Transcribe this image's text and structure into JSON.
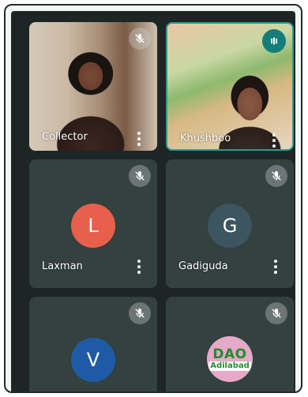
{
  "participants": [
    {
      "name": "Collector",
      "type": "video",
      "muted": true
    },
    {
      "name": "Khushboo",
      "type": "video",
      "speaking": true
    },
    {
      "name": "Laxman",
      "type": "avatar",
      "initial": "L",
      "avatar_color": "#e8604c",
      "muted": true
    },
    {
      "name": "Gadiguda",
      "type": "avatar",
      "initial": "G",
      "avatar_color": "#3c5560",
      "muted": true
    },
    {
      "name": "",
      "type": "avatar",
      "initial": "V",
      "avatar_color": "#1f5aa6",
      "muted": true
    },
    {
      "name": "",
      "type": "logo",
      "logo_text": "DAO",
      "logo_subtext": "Adilabad",
      "muted": true
    }
  ],
  "icons": {
    "mute": "mic-off-icon",
    "speaking": "audio-level-icon",
    "menu": "more-vert-icon"
  },
  "colors": {
    "background": "#1d2625",
    "tile": "#33413f",
    "active_speaker": "#137e79"
  }
}
